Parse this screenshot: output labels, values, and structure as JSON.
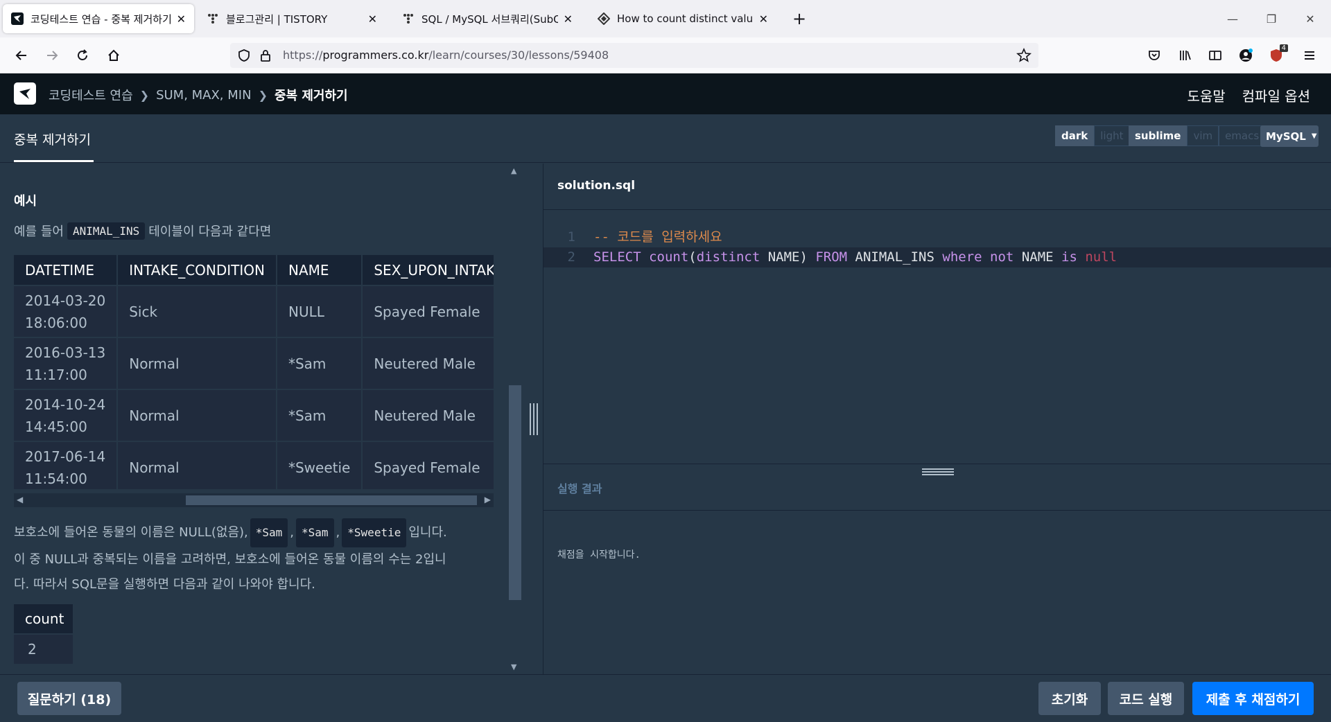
{
  "browser": {
    "tabs": [
      {
        "title": "코딩테스트 연습 - 중복 제거하기",
        "active": true
      },
      {
        "title": "블로그관리 | TISTORY",
        "active": false
      },
      {
        "title": "SQL / MySQL 서브쿼리(SubQuery)",
        "active": false
      },
      {
        "title": "How to count distinct values in SQL",
        "active": false
      }
    ],
    "url_prefix": "https://",
    "url_host": "programmers.co.kr",
    "url_path": "/learn/courses/30/lessons/59408",
    "extension_badge": "4"
  },
  "header": {
    "breadcrumbs": [
      "코딩테스트 연습",
      "SUM, MAX, MIN",
      "중복 제거하기"
    ],
    "help": "도움말",
    "compile_options": "컴파일 옵션"
  },
  "problem": {
    "title": "중복 제거하기"
  },
  "options": {
    "theme": [
      "dark",
      "light"
    ],
    "keymap": [
      "sublime",
      "vim",
      "emacs"
    ],
    "language": "MySQL"
  },
  "description": {
    "example_heading": "예시",
    "intro_before": "예를 들어",
    "intro_code": "ANIMAL_INS",
    "intro_after": "테이블이 다음과 같다면",
    "table": {
      "headers": [
        "DATETIME",
        "INTAKE_CONDITION",
        "NAME",
        "SEX_UPON_INTAKE"
      ],
      "rows": [
        {
          "date": "2014-03-20",
          "time": "18:06:00",
          "cond": "Sick",
          "name": "NULL",
          "sex": "Spayed Female"
        },
        {
          "date": "2016-03-13",
          "time": "11:17:00",
          "cond": "Normal",
          "name": "*Sam",
          "sex": "Neutered Male"
        },
        {
          "date": "2014-10-24",
          "time": "14:45:00",
          "cond": "Normal",
          "name": "*Sam",
          "sex": "Neutered Male"
        },
        {
          "date": "2017-06-14",
          "time": "11:54:00",
          "cond": "Normal",
          "name": "*Sweetie",
          "sex": "Spayed Female"
        }
      ]
    },
    "para_l1_a": "보호소에 들어온 동물의 이름은 NULL(없음),",
    "para_code1": "*Sam",
    "para_comma1": ",",
    "para_code2": "*Sam",
    "para_comma2": ",",
    "para_code3": "*Sweetie",
    "para_l1_b": "입니다.",
    "para_l2": "이 중 NULL과 중복되는 이름을 고려하면, 보호소에 들어온 동물 이름의 수는 2입니",
    "para_l3": "다. 따라서 SQL문을 실행하면 다음과 같이 나와야 합니다.",
    "result_table": {
      "header": "count",
      "value": "2"
    }
  },
  "editor": {
    "filename": "solution.sql",
    "lines": [
      {
        "num": "1",
        "comment": "-- 코드를 입력하세요"
      },
      {
        "num": "2",
        "t1": "SELECT",
        "t2": "count",
        "t3": "(",
        "t4": "distinct",
        "t5": " NAME) ",
        "t6": "FROM",
        "t7": " ANIMAL_INS ",
        "t8": "where",
        "t9": " ",
        "t10": "not",
        "t11": " NAME ",
        "t12": "is",
        "t13": " ",
        "t14": "null"
      }
    ]
  },
  "result": {
    "label": "실행 결과",
    "message": "채점을 시작합니다."
  },
  "buttons": {
    "question": "질문하기 (18)",
    "reset": "초기화",
    "run": "코드 실행",
    "submit": "제출 후 채점하기"
  }
}
